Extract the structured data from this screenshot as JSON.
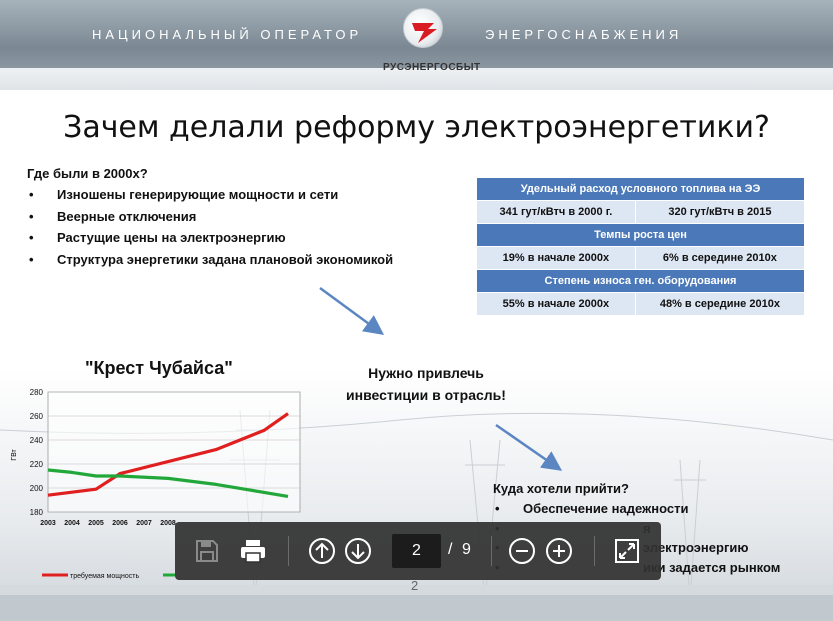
{
  "header": {
    "left_text": "НАЦИОНАЛЬНЫЙ ОПЕРАТОР",
    "right_text": "ЭНЕРГОСНАБЖЕНИЯ",
    "brand": "РУСЭНЕРГОСБЫТ"
  },
  "slide": {
    "title": "Зачем делали реформу электроэнергетики?",
    "where_heading": "Где были в 2000х?",
    "where_items": [
      "Изношены генерирующие мощности и сети",
      "Веерные отключения",
      "Растущие цены на электроэнергию",
      "Структура энергетики задана плановой экономикой"
    ],
    "table": {
      "header1": "Удельный расход условного топлива на ЭЭ",
      "row1_a": "341 гут/кВтч в 2000 г.",
      "row1_b": "320 гут/кВтч в 2015",
      "header2": "Темпы роста цен",
      "row2_a": "19% в начале 2000х",
      "row2_b": "6% в середине 2010х",
      "header3": "Степень износа ген. оборудования",
      "row3_a": "55% в начале 2000х",
      "row3_b": "48% в середине 2010х"
    },
    "invest_text_line1": "Нужно привлечь",
    "invest_text_line2": "инвестиции в отрасль!",
    "chart_title": "\"Крест Чубайса\"",
    "goal_heading": "Куда хотели прийти?",
    "goal_items": [
      "Обеспечение надежности",
      "я",
      "электроэнергию",
      "ики задается рынком"
    ],
    "slide_number": "2"
  },
  "chart_data": {
    "type": "line",
    "ylabel": "ГВт",
    "ylim": [
      180,
      280
    ],
    "yticks": [
      180,
      200,
      220,
      240,
      260,
      280
    ],
    "x": [
      "2003",
      "2004",
      "2005",
      "2006",
      "2007",
      "2008"
    ],
    "series": [
      {
        "name": "требуемая мощность",
        "color": "#e02020",
        "points": [
          [
            2003,
            194
          ],
          [
            2005,
            199
          ],
          [
            2006,
            212
          ],
          [
            2010,
            232
          ],
          [
            2012,
            248
          ],
          [
            2013,
            262
          ]
        ]
      },
      {
        "name": "",
        "color": "#22a83a",
        "points": [
          [
            2003,
            215
          ],
          [
            2004,
            213
          ],
          [
            2005,
            210
          ],
          [
            2006,
            210
          ],
          [
            2008,
            208
          ],
          [
            2010,
            203
          ],
          [
            2013,
            193
          ]
        ]
      }
    ],
    "xlim": [
      2003,
      2013.5
    ]
  },
  "toolbar": {
    "current_page": "2",
    "separator": "/",
    "total_pages": "9"
  },
  "colors": {
    "table_header": "#4a78b9",
    "table_cell": "#dde6f3",
    "arrow": "#5b86c2",
    "toolbar_bg": "#323232"
  }
}
